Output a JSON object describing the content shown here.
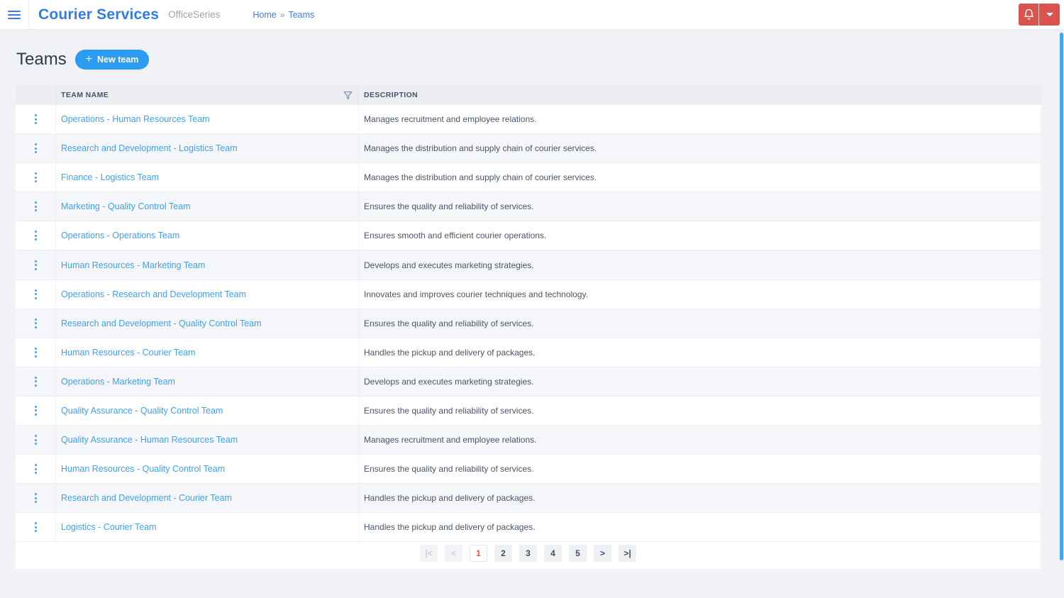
{
  "header": {
    "brand": "Courier Services",
    "subtitle": "OfficeSeries",
    "breadcrumb": {
      "home": "Home",
      "separator": "»",
      "current": "Teams"
    }
  },
  "page": {
    "title": "Teams",
    "new_team_plus": "+",
    "new_team_label": "New team"
  },
  "table": {
    "columns": {
      "team_name": "TEAM NAME",
      "description": "DESCRIPTION"
    },
    "rows": [
      {
        "name": "Operations - Human Resources Team",
        "description": "Manages recruitment and employee relations."
      },
      {
        "name": "Research and Development - Logistics Team",
        "description": "Manages the distribution and supply chain of courier services."
      },
      {
        "name": "Finance - Logistics Team",
        "description": "Manages the distribution and supply chain of courier services."
      },
      {
        "name": "Marketing - Quality Control Team",
        "description": "Ensures the quality and reliability of services."
      },
      {
        "name": "Operations - Operations Team",
        "description": "Ensures smooth and efficient courier operations."
      },
      {
        "name": "Human Resources - Marketing Team",
        "description": "Develops and executes marketing strategies."
      },
      {
        "name": "Operations - Research and Development Team",
        "description": "Innovates and improves courier techniques and technology."
      },
      {
        "name": "Research and Development - Quality Control Team",
        "description": "Ensures the quality and reliability of services."
      },
      {
        "name": "Human Resources - Courier Team",
        "description": "Handles the pickup and delivery of packages."
      },
      {
        "name": "Operations - Marketing Team",
        "description": "Develops and executes marketing strategies."
      },
      {
        "name": "Quality Assurance - Quality Control Team",
        "description": "Ensures the quality and reliability of services."
      },
      {
        "name": "Quality Assurance - Human Resources Team",
        "description": "Manages recruitment and employee relations."
      },
      {
        "name": "Human Resources - Quality Control Team",
        "description": "Ensures the quality and reliability of services."
      },
      {
        "name": "Research and Development - Courier Team",
        "description": "Handles the pickup and delivery of packages."
      },
      {
        "name": "Logistics - Courier Team",
        "description": "Handles the pickup and delivery of packages."
      }
    ]
  },
  "pagination": {
    "first_label": "|<",
    "prev_label": "<",
    "pages": [
      "1",
      "2",
      "3",
      "4",
      "5"
    ],
    "active_page": "1",
    "next_label": ">",
    "last_label": ">|"
  },
  "icons": {
    "hamburger": "menu-icon",
    "bell": "notification-bell-icon",
    "caret": "chevron-down-icon",
    "filter": "filter-funnel-icon",
    "kebab": "row-actions-icon",
    "plus": "plus-icon"
  },
  "colors": {
    "brand_blue": "#2f7ceb",
    "accent_blue": "#2b9cf2",
    "link_blue": "#3da1f2",
    "danger_red": "#d9534f",
    "scrollbar_blue": "#42a4f5",
    "active_page_text": "#e0524a",
    "title_text": "#2e3a4e",
    "page_background": "#f0f2f5"
  }
}
